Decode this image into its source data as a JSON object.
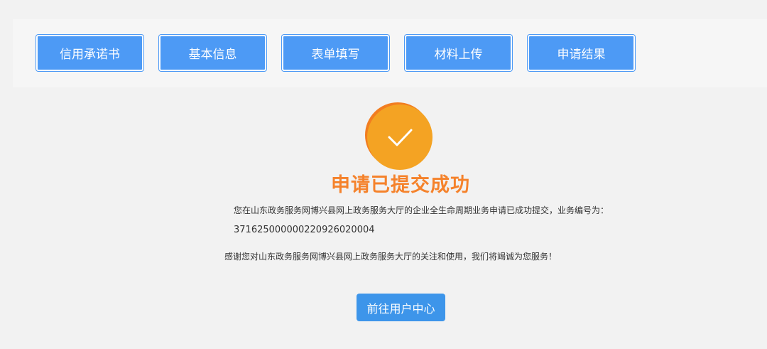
{
  "steps": [
    {
      "label": "信用承诺书"
    },
    {
      "label": "基本信息"
    },
    {
      "label": "表单填写"
    },
    {
      "label": "材料上传"
    },
    {
      "label": "申请结果"
    }
  ],
  "result": {
    "icon": "check-icon",
    "title": "申请已提交成功",
    "message_line1": "您在山东政务服务网博兴县网上政务服务大厅的企业全生命周期业务申请已成功提交，业务编号为：",
    "business_number": "371625000000220926020004",
    "thanks": "感谢您对山东政务服务网博兴县网上政务服务大厅的关注和使用，我们将竭诚为您服务！",
    "button_label": "前往用户中心"
  },
  "colors": {
    "step_bg": "#4d9af5",
    "accent_orange": "#f5822b",
    "badge": "#f4a323",
    "button_bg": "#3d95ea"
  }
}
